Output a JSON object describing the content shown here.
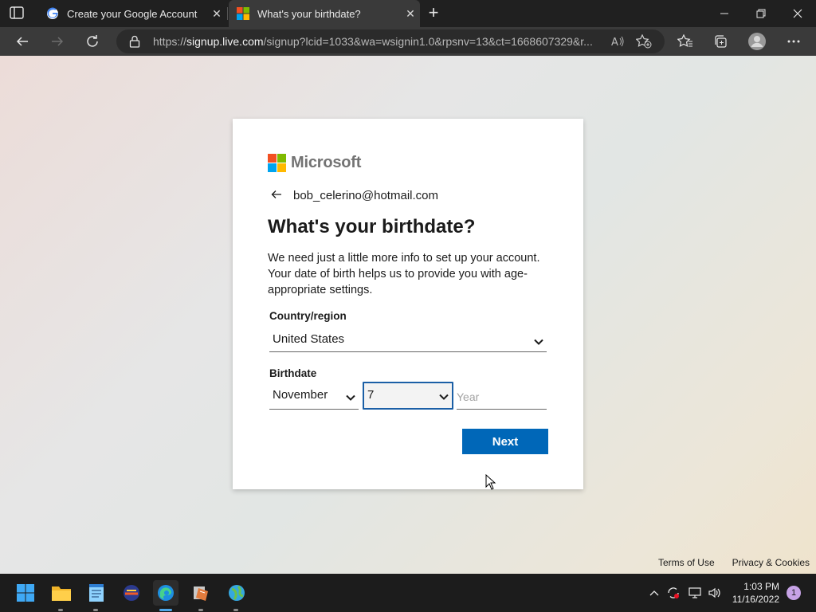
{
  "browser": {
    "tabs": [
      {
        "title": "Create your Google Account",
        "active": false
      },
      {
        "title": "What's your birthdate?",
        "active": true
      }
    ],
    "url_prefix": "https://",
    "url_host": "signup.live.com",
    "url_rest": "/signup?lcid=1033&wa=wsignin1.0&rpsnv=13&ct=1668607329&r..."
  },
  "signup": {
    "brand": "Microsoft",
    "email": "bob_celerino@hotmail.com",
    "heading": "What's your birthdate?",
    "description": "We need just a little more info to set up your account. Your date of birth helps us to provide you with age-appropriate settings.",
    "country_label": "Country/region",
    "country_value": "United States",
    "birthdate_label": "Birthdate",
    "month_value": "November",
    "day_value": "7",
    "year_placeholder": "Year",
    "next_label": "Next"
  },
  "footer": {
    "terms": "Terms of Use",
    "privacy": "Privacy & Cookies"
  },
  "taskbar": {
    "time": "1:03 PM",
    "date": "11/16/2022",
    "notification_count": "1"
  },
  "colors": {
    "accent": "#0067b8",
    "focus_border": "#1b5fa6",
    "ms_red": "#f25022",
    "ms_green": "#7fba00",
    "ms_blue": "#00a4ef",
    "ms_yellow": "#ffb900"
  }
}
